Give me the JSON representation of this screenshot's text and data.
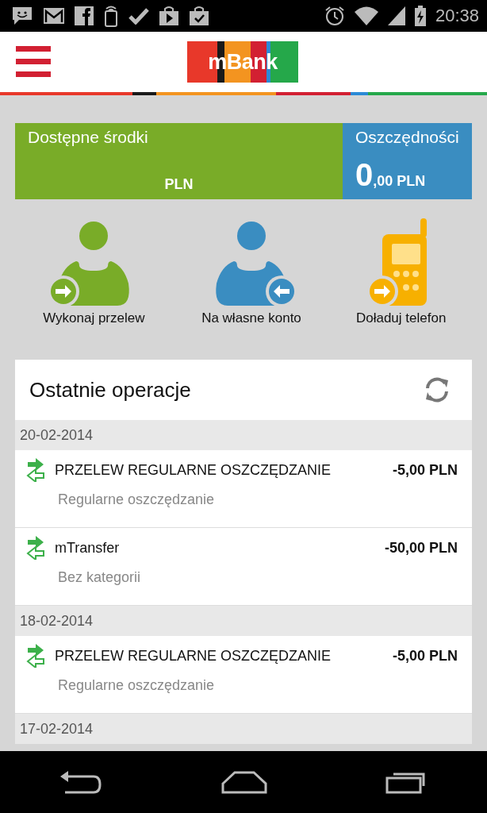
{
  "status_bar": {
    "time": "20:38"
  },
  "header": {
    "logo": "mBank"
  },
  "balances": {
    "available": {
      "label": "Dostępne środki",
      "currency": "PLN"
    },
    "savings": {
      "label": "Oszczędności",
      "amount_integer": "0",
      "amount_rest": ",00 PLN"
    }
  },
  "actions": [
    {
      "kind": "outgoing",
      "label": "Wykonaj przelew"
    },
    {
      "kind": "incoming",
      "label": "Na własne konto"
    },
    {
      "kind": "phone",
      "label": "Doładuj telefon"
    }
  ],
  "recent": {
    "title": "Ostatnie operacje",
    "groups": [
      {
        "date": "20-02-2014",
        "items": [
          {
            "title": "PRZELEW REGULARNE OSZCZĘDZANIE",
            "amount": "-5,00 PLN",
            "category": "Regularne oszczędzanie"
          },
          {
            "title": "mTransfer",
            "amount": "-50,00 PLN",
            "category": "Bez kategorii"
          }
        ]
      },
      {
        "date": "18-02-2014",
        "items": [
          {
            "title": "PRZELEW REGULARNE OSZCZĘDZANIE",
            "amount": "-5,00 PLN",
            "category": "Regularne oszczędzanie"
          }
        ]
      },
      {
        "date": "17-02-2014"
      }
    ]
  }
}
